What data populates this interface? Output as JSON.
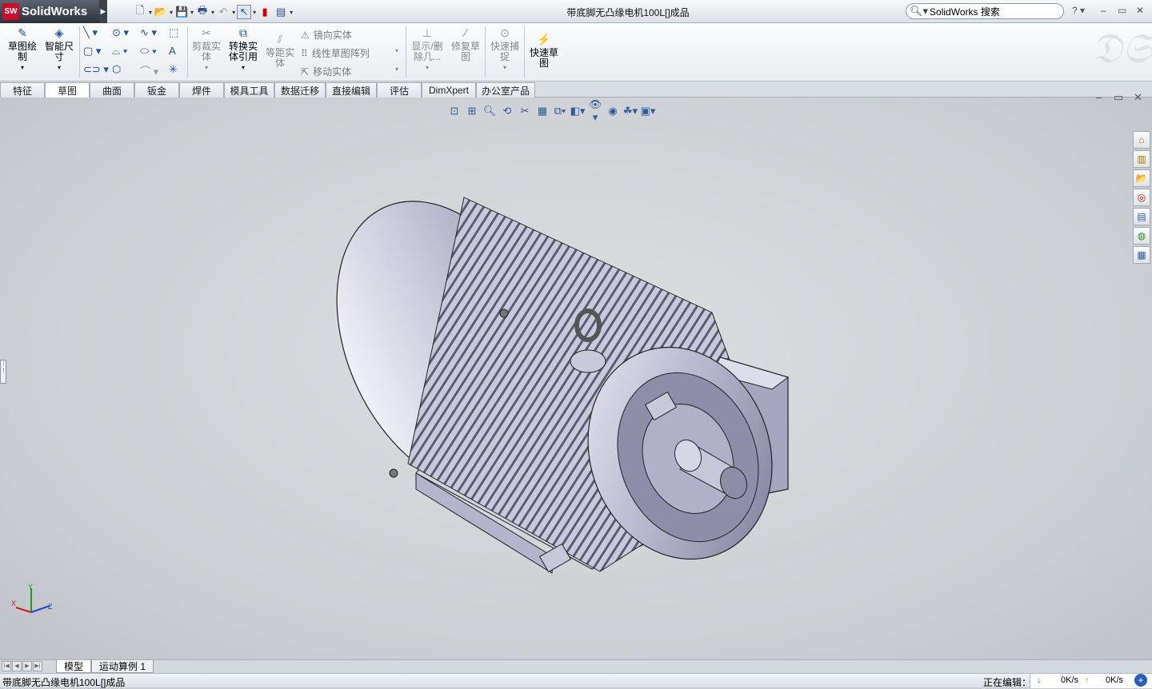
{
  "app": {
    "name": "SolidWorks",
    "logo_mark": "SW"
  },
  "window": {
    "title": "带底脚无凸缘电机100L[]成品"
  },
  "search": {
    "label": "SolidWorks 搜索"
  },
  "quick_access": {
    "icons": [
      "new-document-icon",
      "open-folder-icon",
      "save-icon",
      "print-icon",
      "undo-icon",
      "select-arrow-icon",
      "rebuild-traffic-light-icon",
      "options-icon"
    ]
  },
  "command_manager": {
    "sketch": "草图绘\n制",
    "smart_dimension": "智能尺\n寸",
    "trim": "剪裁实\n体",
    "convert": "转换实\n体引用",
    "offset": "等距实\n体",
    "mirror": "镜向实体",
    "linear_pattern": "线性草图阵列",
    "move": "移动实体",
    "show_delete": "显示/删\n除几...",
    "repair": "修复草\n图",
    "quick_snap": "快速捕\n捉",
    "rapid_sketch": "快速草\n图"
  },
  "tabs": [
    "特征",
    "草图",
    "曲面",
    "钣金",
    "焊件",
    "模具工具",
    "数据迁移",
    "直接编辑",
    "评估",
    "DimXpert",
    "办公室产品"
  ],
  "active_tab": "草图",
  "bottom_tabs": [
    "模型",
    "运动算例 1"
  ],
  "active_bottom_tab": "模型",
  "status": {
    "file": "带底脚无凸缘电机100L[]成品",
    "editing": "正在编辑：",
    "down_speed": "0K/s",
    "up_speed": "0K/s"
  },
  "triad": {
    "x": "X",
    "y": "Y",
    "z": "Z"
  },
  "colors": {
    "accent": "#1f4f9e",
    "viewport": "#cbced2",
    "model": "#b8b8d2"
  }
}
